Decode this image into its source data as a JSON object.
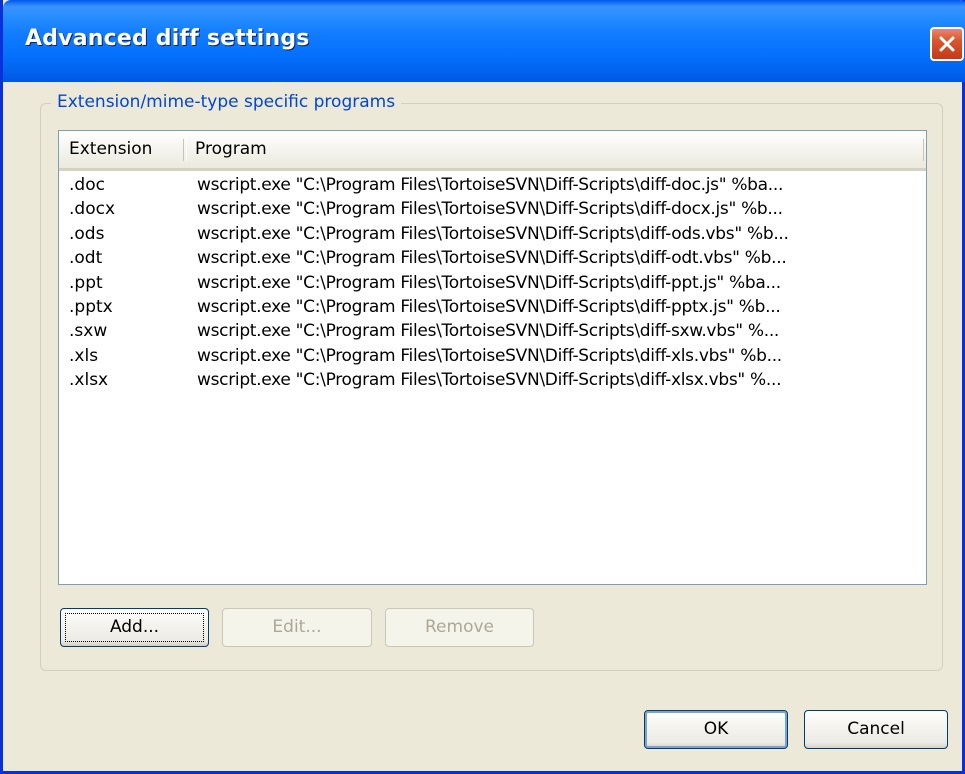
{
  "window": {
    "title": "Advanced diff settings"
  },
  "group": {
    "label": "Extension/mime-type specific programs"
  },
  "table": {
    "columns": [
      "Extension",
      "Program"
    ],
    "rows": [
      {
        "ext": ".doc",
        "program": "wscript.exe \"C:\\Program Files\\TortoiseSVN\\Diff-Scripts\\diff-doc.js\" %ba..."
      },
      {
        "ext": ".docx",
        "program": "wscript.exe \"C:\\Program Files\\TortoiseSVN\\Diff-Scripts\\diff-docx.js\" %b..."
      },
      {
        "ext": ".ods",
        "program": "wscript.exe \"C:\\Program Files\\TortoiseSVN\\Diff-Scripts\\diff-ods.vbs\" %b..."
      },
      {
        "ext": ".odt",
        "program": "wscript.exe \"C:\\Program Files\\TortoiseSVN\\Diff-Scripts\\diff-odt.vbs\" %b..."
      },
      {
        "ext": ".ppt",
        "program": "wscript.exe \"C:\\Program Files\\TortoiseSVN\\Diff-Scripts\\diff-ppt.js\" %ba..."
      },
      {
        "ext": ".pptx",
        "program": "wscript.exe \"C:\\Program Files\\TortoiseSVN\\Diff-Scripts\\diff-pptx.js\" %b..."
      },
      {
        "ext": ".sxw",
        "program": "wscript.exe \"C:\\Program Files\\TortoiseSVN\\Diff-Scripts\\diff-sxw.vbs\" %..."
      },
      {
        "ext": ".xls",
        "program": "wscript.exe \"C:\\Program Files\\TortoiseSVN\\Diff-Scripts\\diff-xls.vbs\" %b..."
      },
      {
        "ext": ".xlsx",
        "program": "wscript.exe \"C:\\Program Files\\TortoiseSVN\\Diff-Scripts\\diff-xlsx.vbs\" %..."
      }
    ]
  },
  "buttons": {
    "add": "Add...",
    "edit": "Edit...",
    "remove": "Remove",
    "ok": "OK",
    "cancel": "Cancel"
  },
  "icons": {
    "close": "close-icon"
  },
  "colors": {
    "titlebar": "#0058EE",
    "dialog_bg": "#ECE9D8",
    "group_label": "#0046D5",
    "close_button": "#D9542F"
  }
}
